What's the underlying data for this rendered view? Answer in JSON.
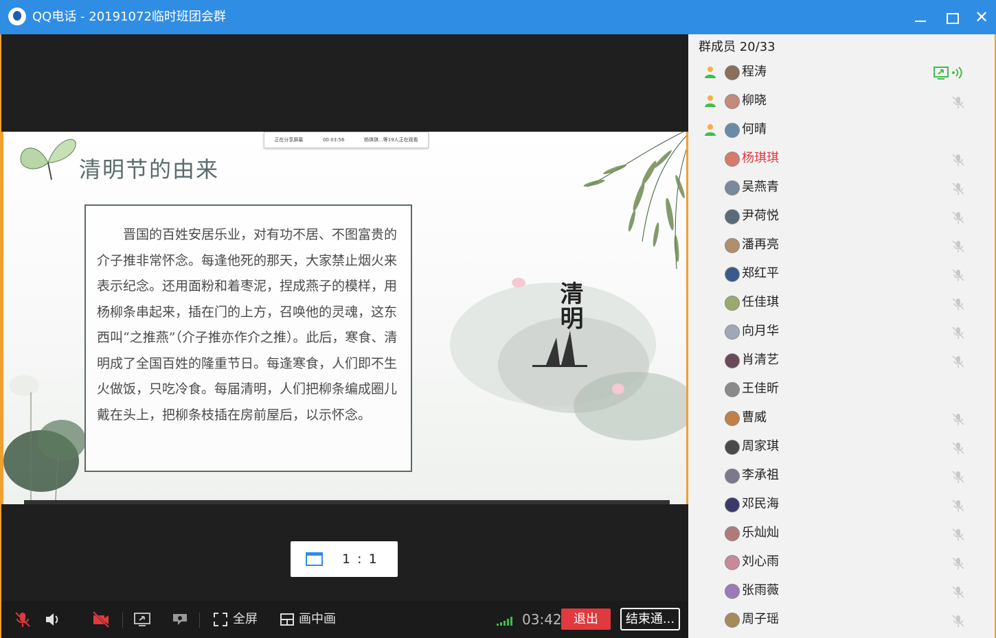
{
  "window": {
    "title": "QQ电话 - 20191072临时班团会群",
    "controls": [
      "minimize-icon",
      "maximize-icon",
      "close-icon"
    ]
  },
  "share_bar": {
    "status": "正在分享屏幕",
    "elapsed": "00:03:56",
    "viewers": "杨琪琪...等19人正在观看"
  },
  "slide": {
    "title": "清明节的由来",
    "paragraph": "晋国的百姓安居乐业，对有功不居、不图富贵的介子推非常怀念。每逢他死的那天，大家禁止烟火来表示纪念。还用面粉和着枣泥，捏成燕子的模样，用杨柳条串起来，插在门的上方，召唤他的灵魂，这东西叫“之推燕”（介子推亦作介之推）。此后，寒食、清明成了全国百姓的隆重节日。每逢寒食，人们即不生火做饭，只吃冷食。每届清明，人们把柳条编成圈儿戴在头上，把柳条枝插在房前屋后，以示怀念。",
    "calligraphy": "清明"
  },
  "ratio_button": {
    "label": "1 : 1"
  },
  "toolbar": {
    "mic": "mic-muted-icon",
    "speaker": "speaker-icon",
    "camera": "camera-off-icon",
    "share_screen": "share-screen-icon",
    "presentation": "presentation-icon",
    "fullscreen_label": "全屏",
    "pip_label": "画中画",
    "timer": "03:42",
    "exit_label": "退出",
    "end_label": "结束通..."
  },
  "members": {
    "header": "群成员 20/33",
    "list": [
      {
        "name": "程涛",
        "host": true,
        "status": "sharing",
        "speaking": false
      },
      {
        "name": "柳晓",
        "host": true,
        "status": "muted",
        "speaking": false
      },
      {
        "name": "何晴",
        "host": true,
        "status": "none",
        "speaking": false
      },
      {
        "name": "杨琪琪",
        "host": false,
        "status": "muted",
        "speaking": true
      },
      {
        "name": "吴燕青",
        "host": false,
        "status": "muted",
        "speaking": false
      },
      {
        "name": "尹荷悦",
        "host": false,
        "status": "muted",
        "speaking": false
      },
      {
        "name": "潘再亮",
        "host": false,
        "status": "muted",
        "speaking": false
      },
      {
        "name": "郑红平",
        "host": false,
        "status": "muted",
        "speaking": false
      },
      {
        "name": "任佳琪",
        "host": false,
        "status": "muted",
        "speaking": false
      },
      {
        "name": "向月华",
        "host": false,
        "status": "muted",
        "speaking": false
      },
      {
        "name": "肖清艺",
        "host": false,
        "status": "muted",
        "speaking": false
      },
      {
        "name": "王佳昕",
        "host": false,
        "status": "none",
        "speaking": false
      },
      {
        "name": "曹威",
        "host": false,
        "status": "muted",
        "speaking": false
      },
      {
        "name": "周家琪",
        "host": false,
        "status": "muted",
        "speaking": false
      },
      {
        "name": "李承祖",
        "host": false,
        "status": "muted",
        "speaking": false
      },
      {
        "name": "邓民海",
        "host": false,
        "status": "muted",
        "speaking": false
      },
      {
        "name": "乐灿灿",
        "host": false,
        "status": "muted",
        "speaking": false
      },
      {
        "name": "刘心雨",
        "host": false,
        "status": "muted",
        "speaking": false
      },
      {
        "name": "张雨薇",
        "host": false,
        "status": "muted",
        "speaking": false
      },
      {
        "name": "周子瑶",
        "host": false,
        "status": "muted",
        "speaking": false
      }
    ]
  },
  "colors": {
    "titlebar": "#2f8de4",
    "accent_orange": "#f0a030",
    "exit_red": "#e0393e",
    "signal_green": "#3cc04a",
    "host_green": "#3cc04a"
  }
}
